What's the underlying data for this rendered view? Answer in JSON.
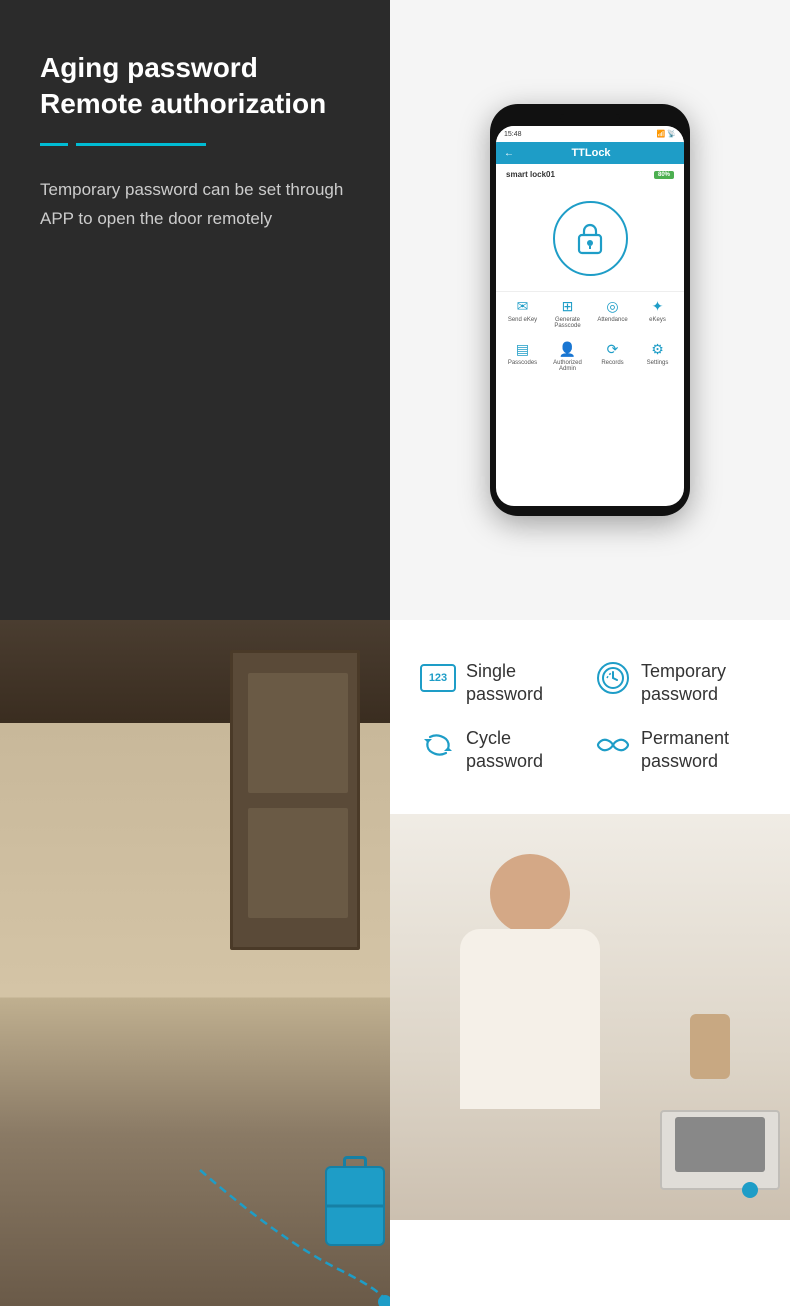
{
  "header": {
    "title": "Aging password\nRemote authorization",
    "divider_short": "",
    "divider_long": "",
    "description": "Temporary password can be set through APP to open the door remotely"
  },
  "phone_app": {
    "status_bar": "15:48",
    "nav_title": "TTLock",
    "nav_back": "←",
    "device_name": "smart lock01",
    "battery": "80%",
    "icons": [
      {
        "symbol": "✉",
        "label": "Send eKey"
      },
      {
        "symbol": "⊞",
        "label": "Generate\nPasscode"
      },
      {
        "symbol": "◎",
        "label": "Attendance"
      },
      {
        "symbol": "✦",
        "label": "eKeys"
      }
    ],
    "icons2": [
      {
        "symbol": "▤",
        "label": "Passcodes"
      },
      {
        "symbol": "♟",
        "label": "Authorized\nAdmin"
      },
      {
        "symbol": "⟳",
        "label": "Records"
      },
      {
        "symbol": "⚙",
        "label": "Settings"
      }
    ]
  },
  "features": [
    {
      "icon_type": "123",
      "label": "Single\npassword"
    },
    {
      "icon_type": "clock",
      "label": "Temporary\npassword"
    },
    {
      "icon_type": "cycle",
      "label": "Cycle\npassword"
    },
    {
      "icon_type": "infinite",
      "label": "Permanent\npassword"
    }
  ],
  "colors": {
    "accent": "#1e9dc7",
    "dark_bg": "#2b2b2b",
    "text_dark": "#333333",
    "text_light": "#cccccc"
  }
}
